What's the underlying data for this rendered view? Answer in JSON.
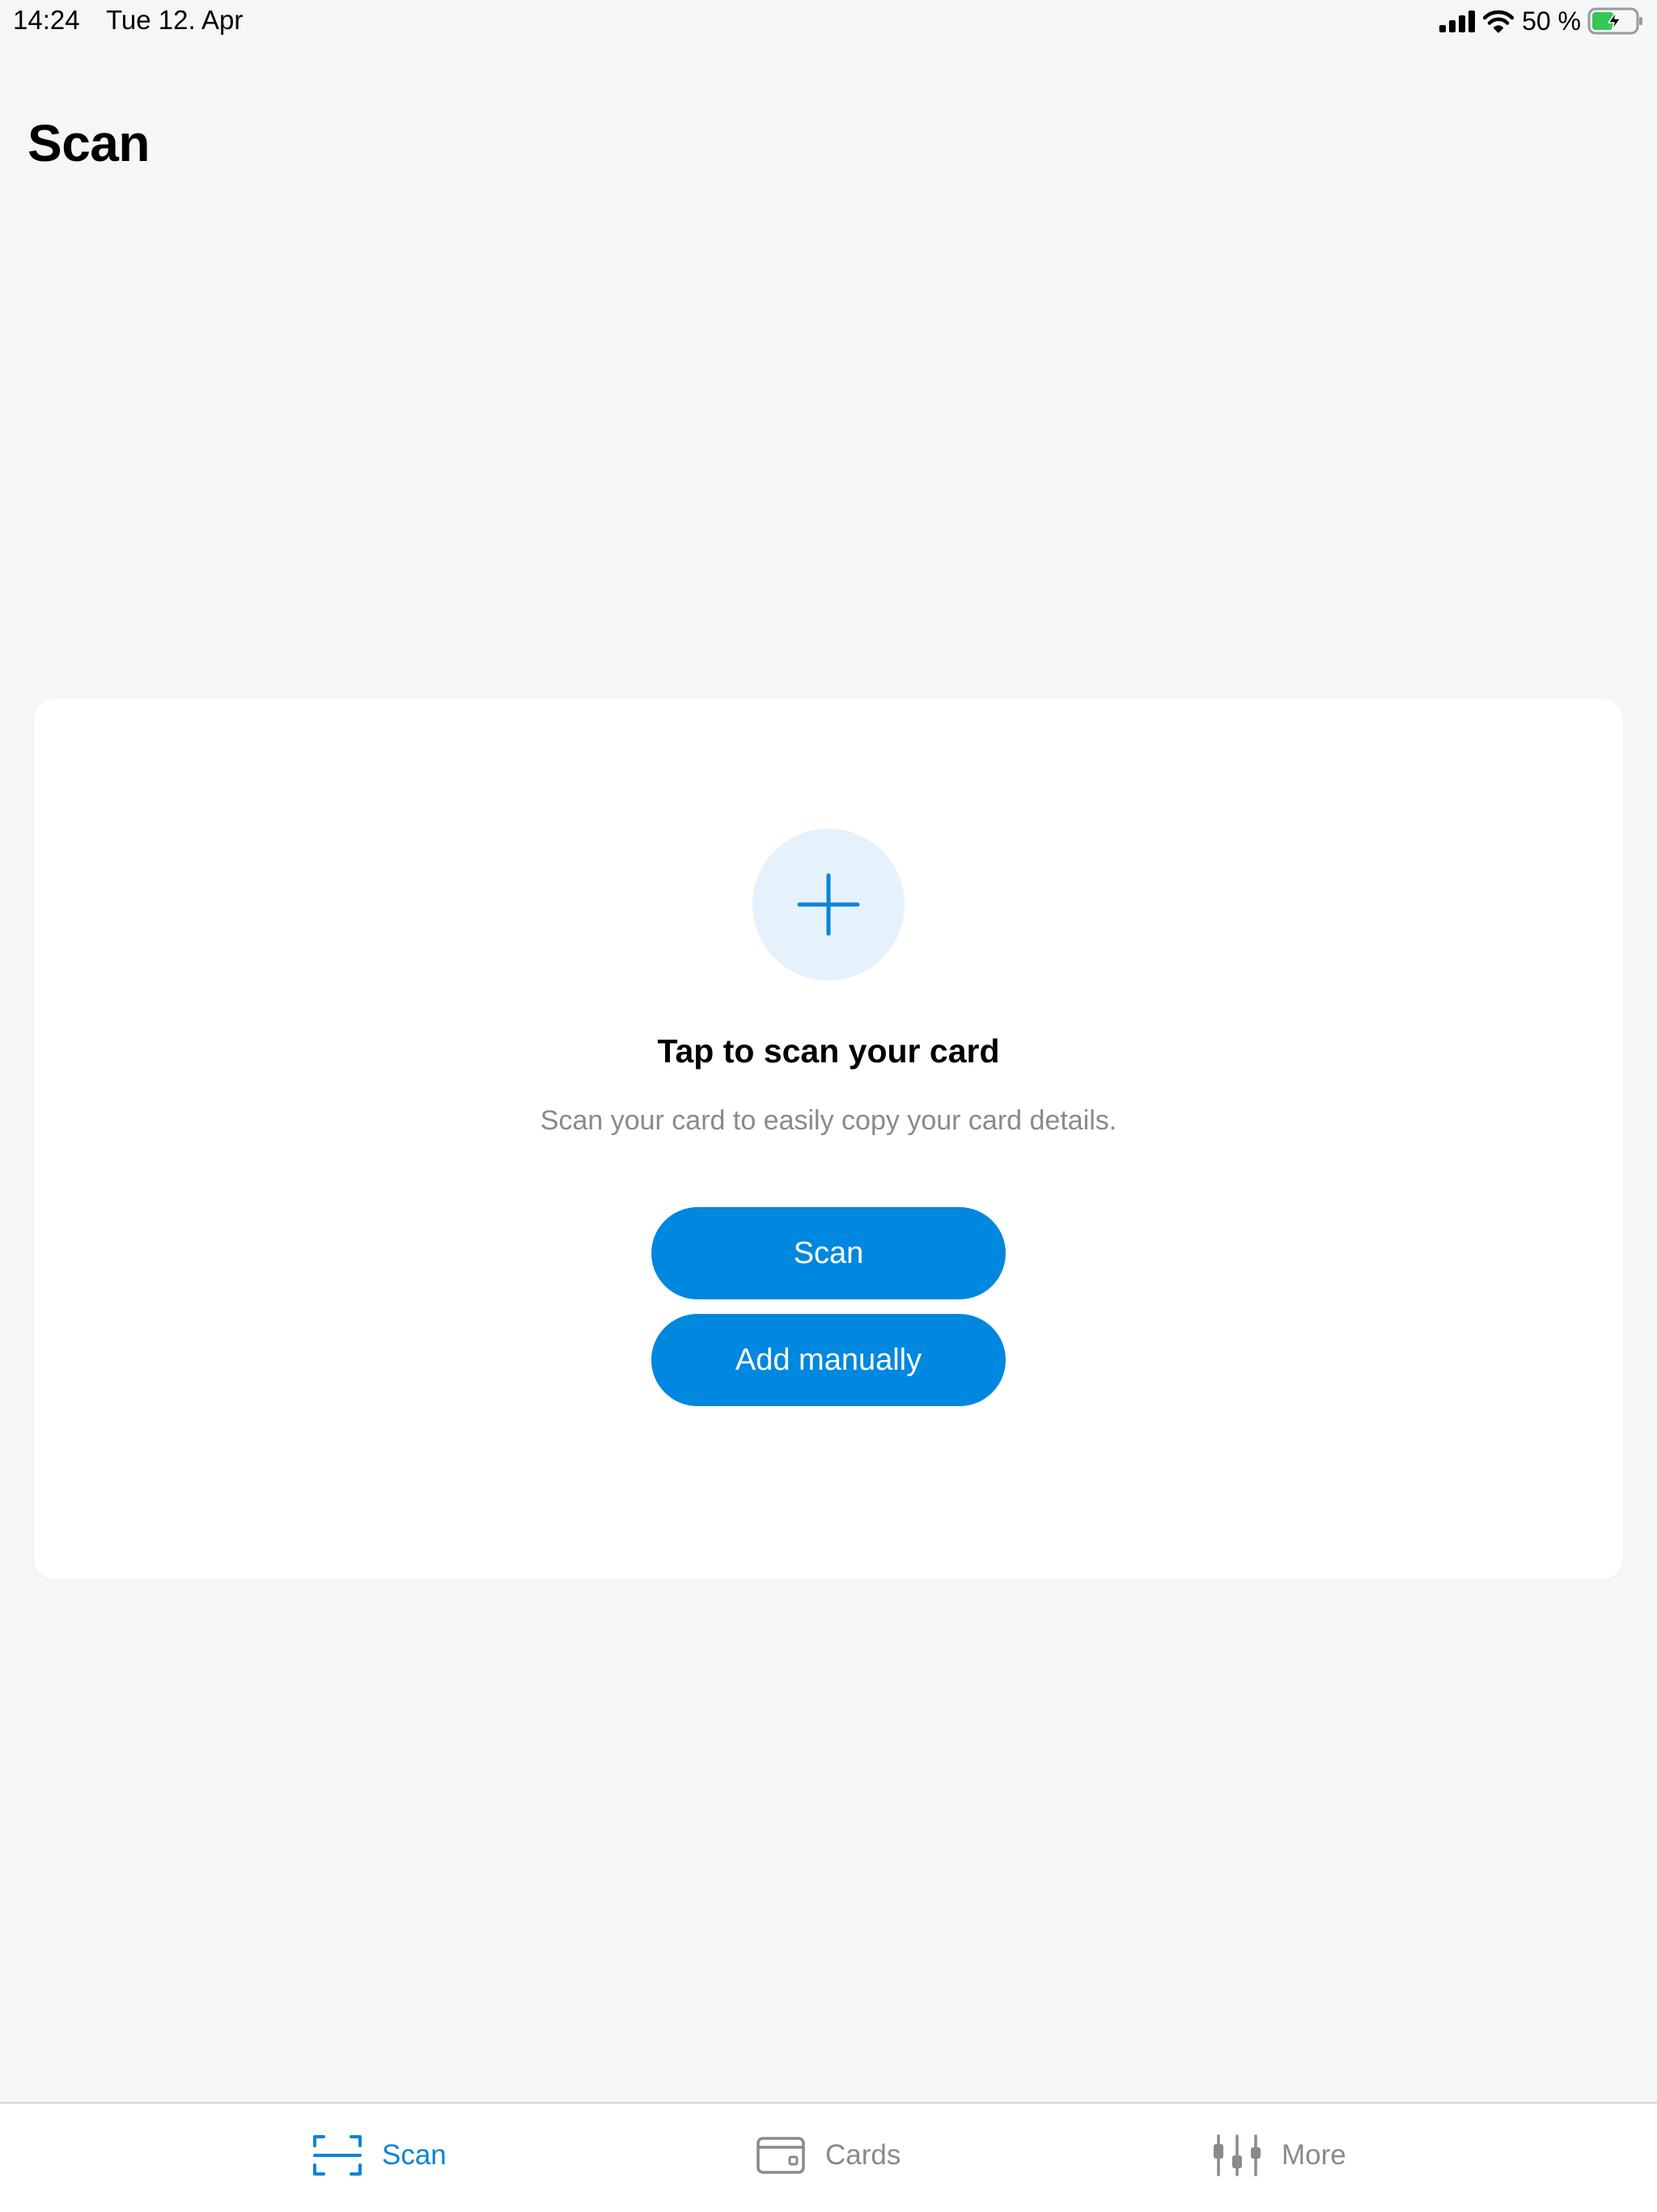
{
  "status_bar": {
    "time": "14:24",
    "date": "Tue 12. Apr",
    "battery_percent": "50 %",
    "battery_level": 0.5,
    "icons": [
      "signal-icon",
      "wifi-icon",
      "battery-charging-icon"
    ]
  },
  "header": {
    "title": "Scan"
  },
  "card": {
    "icon": "plus-icon",
    "title": "Tap to scan your card",
    "subtitle": "Scan your card to easily copy your card details.",
    "scan_button_label": "Scan",
    "add_manually_button_label": "Add manually"
  },
  "tab_bar": {
    "selected": "Scan",
    "items": [
      {
        "label": "Scan",
        "icon": "scan-frame-icon"
      },
      {
        "label": "Cards",
        "icon": "wallet-icon"
      },
      {
        "label": "More",
        "icon": "sliders-icon"
      }
    ]
  },
  "colors": {
    "accent": "#0087df",
    "tab_active": "#0a84d6",
    "background": "#f5f6f8",
    "card_background": "#ffffff",
    "icon_circle_background": "#e5f2fc",
    "secondary_text": "#8a8a8e",
    "battery_green": "#34c759"
  }
}
